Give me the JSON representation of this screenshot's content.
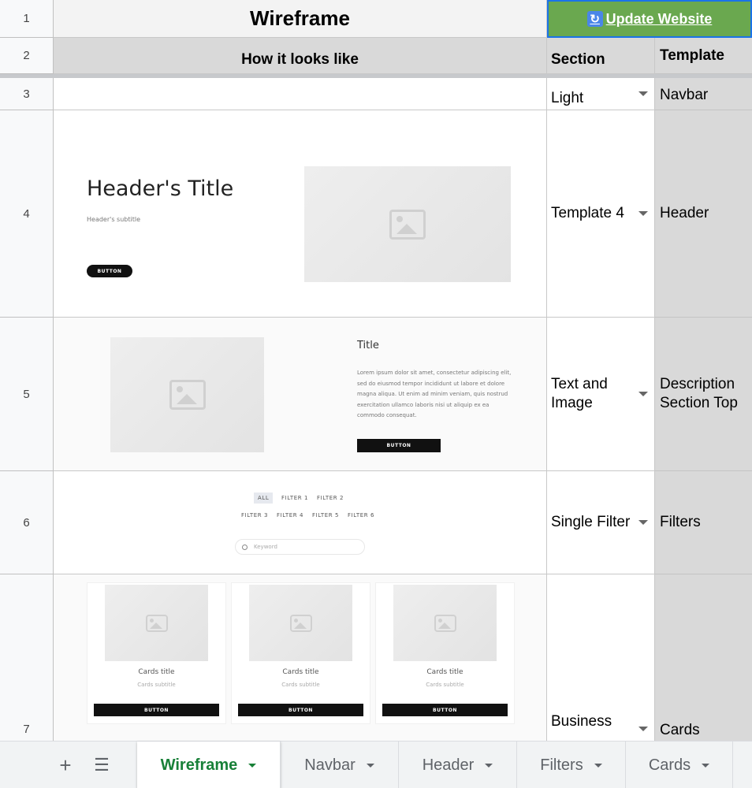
{
  "sheet": {
    "rows": [
      "1",
      "2",
      "3",
      "4",
      "5",
      "6",
      "7"
    ],
    "title": "Wireframe",
    "update_button": "Update Website",
    "headers": {
      "how": "How it looks like",
      "section": "Section",
      "template": "Template"
    },
    "sections": [
      "Light",
      "Template 4",
      "Text and Image",
      "Single Filter",
      "Business"
    ],
    "templates": [
      "Navbar",
      "Header",
      "Description Section Top",
      "Filters",
      "Cards"
    ]
  },
  "wireframes": {
    "header": {
      "title": "Header's Title",
      "subtitle": "Header's subtitle",
      "button": "BUTTON"
    },
    "description": {
      "title": "Title",
      "body": "Lorem ipsum dolor sit amet, consectetur adipiscing elit, sed do eiusmod tempor incididunt ut labore et dolore magna aliqua. Ut enim ad minim veniam, quis nostrud exercitation ullamco laboris nisi ut aliquip ex ea commodo consequat.",
      "button": "BUTTON"
    },
    "filters": {
      "items": [
        "ALL",
        "FILTER 1",
        "FILTER 2",
        "FILTER 3",
        "FILTER 4",
        "FILTER 5",
        "FILTER 6"
      ],
      "search_placeholder": "Keyword"
    },
    "cards": [
      {
        "title": "Cards title",
        "subtitle": "Cards subtitle",
        "button": "BUTTON"
      },
      {
        "title": "Cards title",
        "subtitle": "Cards subtitle",
        "button": "BUTTON"
      },
      {
        "title": "Cards title",
        "subtitle": "Cards subtitle",
        "button": "BUTTON"
      }
    ]
  },
  "tabs": {
    "items": [
      "Wireframe",
      "Navbar",
      "Header",
      "Filters",
      "Cards"
    ],
    "active": "Wireframe",
    "add_icon": "plus-icon",
    "all_sheets_icon": "menu-icon"
  },
  "colors": {
    "update_bg": "#6aa84f",
    "selection": "#1a73e8",
    "active_tab": "#188038",
    "template_bg": "#d9d9d9"
  }
}
